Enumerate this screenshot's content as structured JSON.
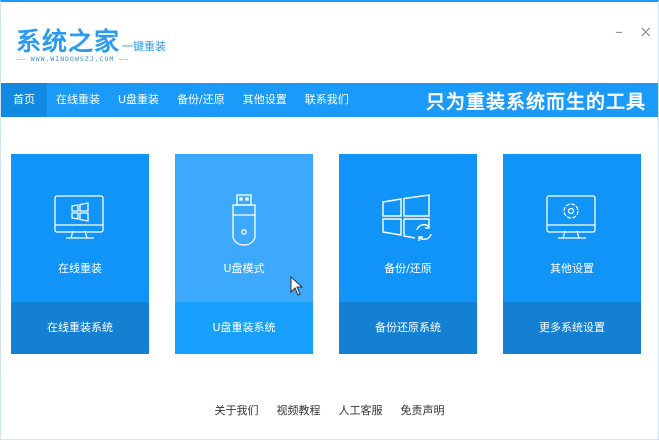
{
  "header": {
    "logo_main": "系统之家",
    "logo_sub": "一键重装",
    "logo_url": "——  WWW.WINDOWSZJ.COM  ——",
    "minimize": "–",
    "close": "×"
  },
  "nav": {
    "items": [
      "首页",
      "在线重装",
      "U盘重装",
      "备份/还原",
      "其他设置",
      "联系我们"
    ],
    "slogan": "只为重装系统而生的工具"
  },
  "cards": [
    {
      "title": "在线重装",
      "action": "在线重装系统",
      "icon": "monitor-windows-icon"
    },
    {
      "title": "U盘模式",
      "action": "U盘重装系统",
      "icon": "usb-drive-icon"
    },
    {
      "title": "备份/还原",
      "action": "备份还原系统",
      "icon": "windows-restore-icon"
    },
    {
      "title": "其他设置",
      "action": "更多系统设置",
      "icon": "monitor-gear-icon"
    }
  ],
  "footer": {
    "links": [
      "关于我们",
      "视频教程",
      "人工客服",
      "免责声明"
    ]
  },
  "colors": {
    "primary": "#1094f8",
    "dark": "#1380d2",
    "hover": "#3ca9fc"
  }
}
